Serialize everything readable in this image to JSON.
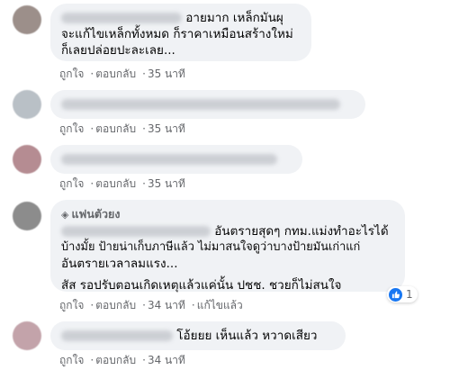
{
  "comments": [
    {
      "lines": [
        "อายมาก เหล็กมันผุ",
        "จะแก้ไขเหล็กทั้งหมด ก็ราคาเหมือนสร้างใหม่",
        "ก็เลยปล่อยปะละเลย..."
      ],
      "actions": {
        "like": "ถูกใจ",
        "reply": "ตอบกลับ",
        "time": "35 นาที"
      }
    },
    {
      "lines": [],
      "actions": {
        "like": "ถูกใจ",
        "reply": "ตอบกลับ",
        "time": "35 นาที"
      }
    },
    {
      "lines": [],
      "actions": {
        "like": "ถูกใจ",
        "reply": "ตอบกลับ",
        "time": "35 นาที"
      }
    },
    {
      "badge": "แฟนตัวยง",
      "lines": [
        "อันตรายสุดๆ กทม.แม่งทำอะไรได้",
        "บ้างมั้ย ป้ายน่าเก็บภาษีแล้ว ไม่มาสนใจดูว่าบางป้ายมันเก่าแก่",
        "อันตรายเวลาลมแรง..."
      ],
      "extra": "สัส รอปรับตอนเกิดเหตุแล้วแค่นั้น ปชช. ชวยก็ไม่สนใจ",
      "actions": {
        "like": "ถูกใจ",
        "reply": "ตอบกลับ",
        "time": "34 นาที",
        "edited": "แก้ไขแล้ว"
      },
      "reaction_count": "1"
    },
    {
      "lines": [
        "โอ้ยยย เห็นแล้ว หวาดเสียว"
      ],
      "actions": {
        "like": "ถูกใจ",
        "reply": "ตอบกลับ",
        "time": "34 นาที"
      }
    }
  ]
}
